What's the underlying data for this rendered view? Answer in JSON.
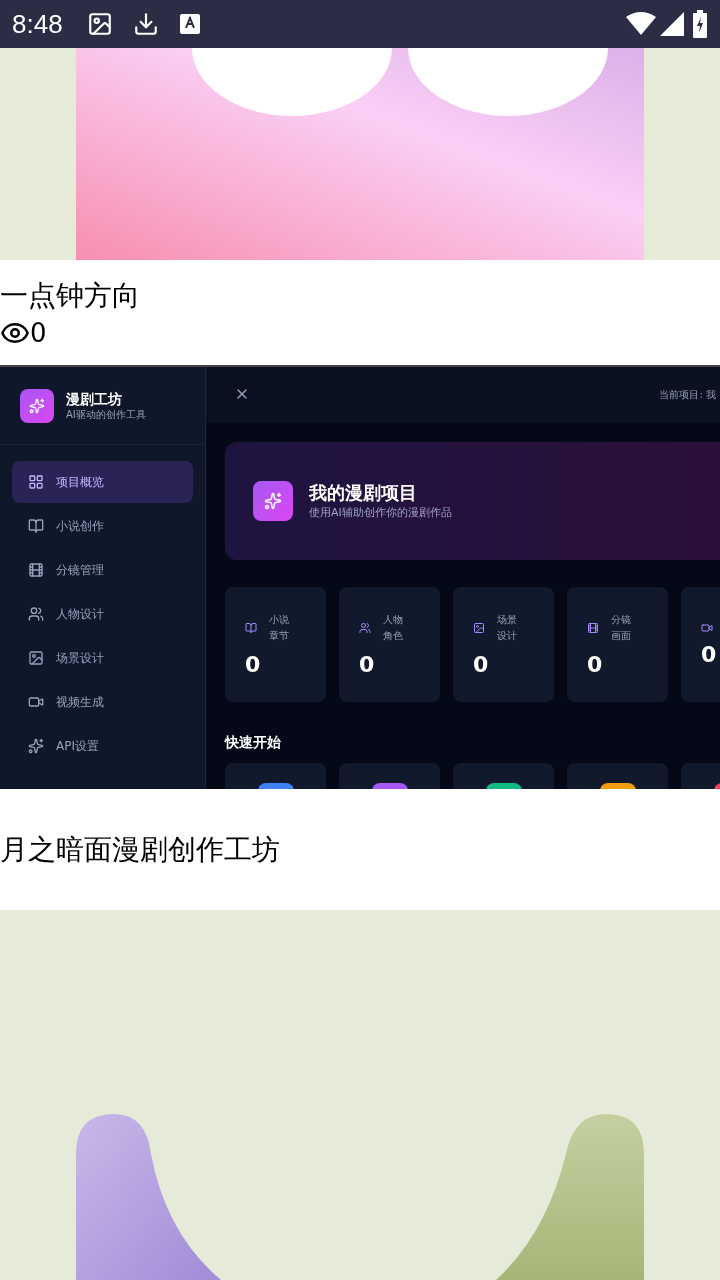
{
  "status_bar": {
    "time": "8:48"
  },
  "post_1": {
    "title": "一点钟方向",
    "views": "0"
  },
  "post_2": {
    "screenshot": {
      "brand": {
        "name": "漫剧工坊",
        "tagline": "AI驱动的创作工具"
      },
      "nav": [
        {
          "label": "项目概览",
          "selected": true
        },
        {
          "label": "小说创作",
          "selected": false
        },
        {
          "label": "分镜管理",
          "selected": false
        },
        {
          "label": "人物设计",
          "selected": false
        },
        {
          "label": "场景设计",
          "selected": false
        },
        {
          "label": "视频生成",
          "selected": false
        },
        {
          "label": "API设置",
          "selected": false
        }
      ],
      "current_project": "当前项目: 我",
      "hero": {
        "title": "我的漫剧项目",
        "subtitle": "使用AI辅助创作你的漫剧作品"
      },
      "stats": [
        {
          "label": "小说章节",
          "value": "0"
        },
        {
          "label": "人物角色",
          "value": "0"
        },
        {
          "label": "场景设计",
          "value": "0"
        },
        {
          "label": "分镜画面",
          "value": "0"
        },
        {
          "value": "0"
        }
      ],
      "quick_start_title": "快速开始",
      "quick_start": [
        {
          "color": "#3b82f6"
        },
        {
          "color": "#a855f7"
        },
        {
          "color": "#10b981"
        },
        {
          "color": "#f59e0b"
        },
        {
          "color": "#f43f5e"
        }
      ]
    },
    "title": "月之暗面漫剧创作工坊"
  }
}
